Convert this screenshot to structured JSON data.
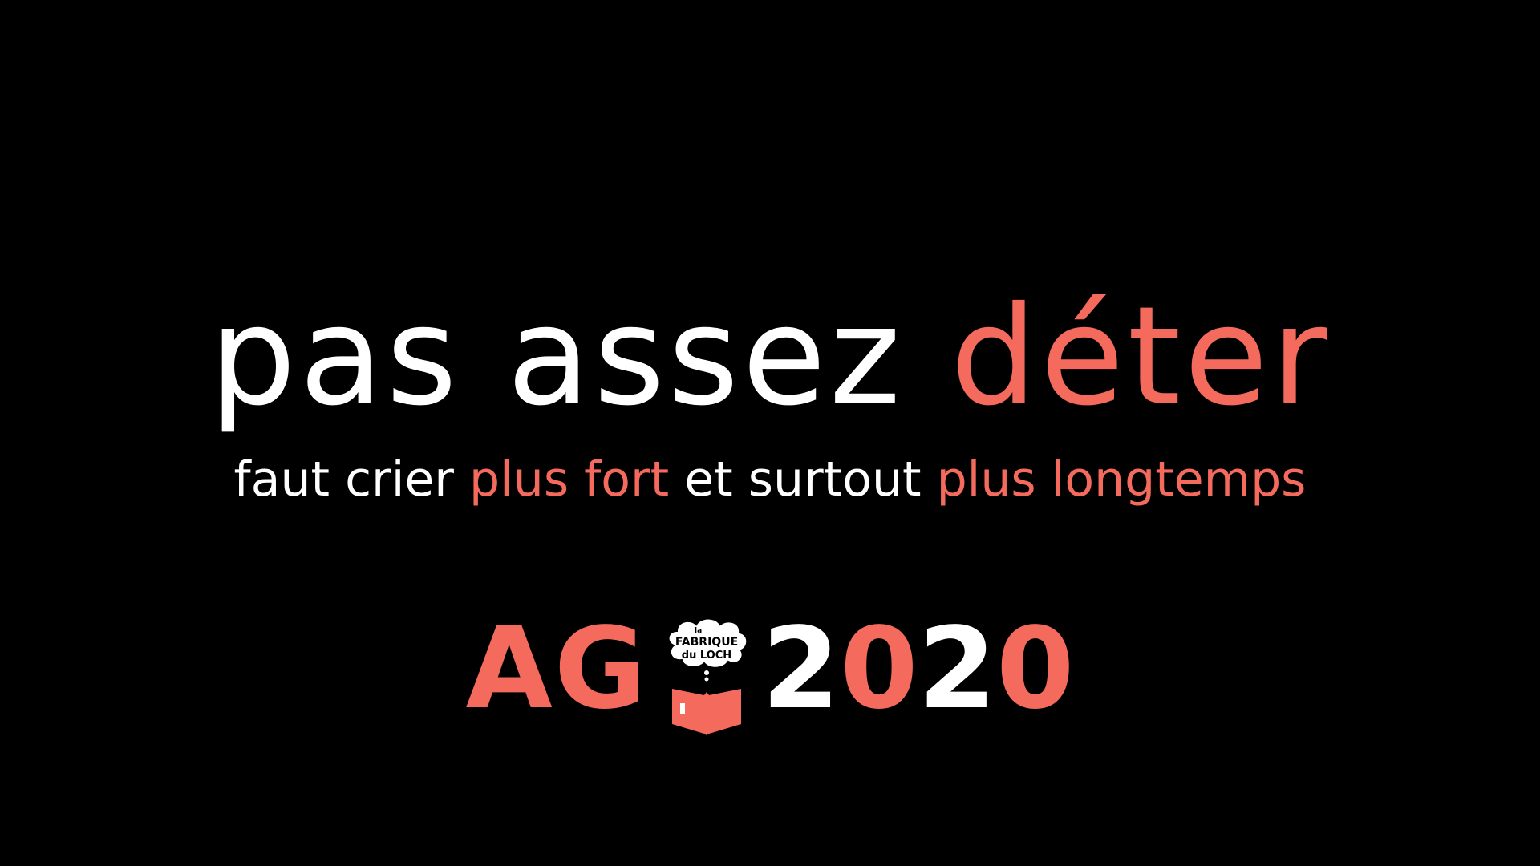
{
  "headline": {
    "part1": "pas assez ",
    "part2": "déter"
  },
  "subline": {
    "part1": "faut crier ",
    "part2": "plus fort",
    "part3": " et surtout ",
    "part4": "plus longtemps"
  },
  "footer": {
    "ag": "AG",
    "logo_line1": "la",
    "logo_line2": "FABRIQUE",
    "logo_line3": "du LOCH",
    "year_digit1": "2",
    "year_digit2": "0",
    "year_digit3": "2",
    "year_digit4": "0"
  },
  "colors": {
    "background": "#000000",
    "white": "#ffffff",
    "accent": "#f46a5c"
  },
  "icons": {
    "logo": "fabrique-du-loch-logo"
  }
}
